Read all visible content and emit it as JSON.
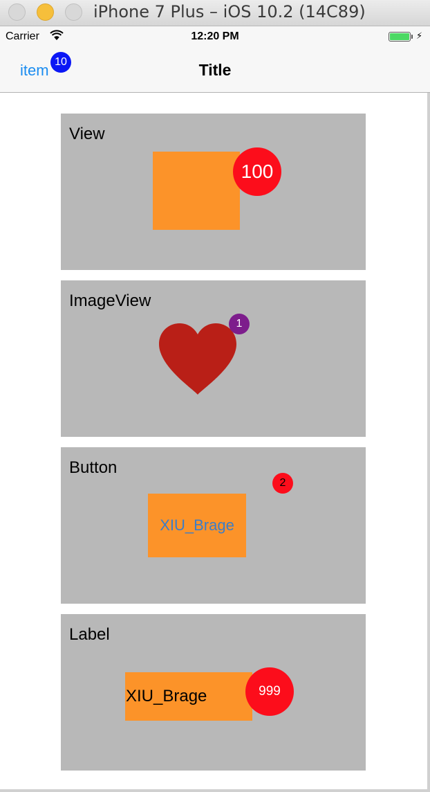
{
  "window": {
    "title": "iPhone 7 Plus – iOS 10.2 (14C89)"
  },
  "statusbar": {
    "carrier": "Carrier",
    "time": "12:20 PM",
    "battery_level": 1.0
  },
  "navbar": {
    "item_label": "item",
    "item_badge": "10",
    "title": "Title"
  },
  "panels": {
    "view": {
      "label": "View",
      "badge": "100"
    },
    "imageview": {
      "label": "ImageView",
      "badge": "1"
    },
    "button": {
      "label": "Button",
      "button_text": "XIU_Brage",
      "badge": "2"
    },
    "label": {
      "label": "Label",
      "label_text": "XIU_Brage",
      "badge": "999"
    }
  },
  "colors": {
    "orange": "#fc9329",
    "badge_red": "#fc0d1b",
    "badge_blue": "#0b17f5",
    "badge_purple": "#7d1d8c",
    "heart_red": "#b91f17",
    "panel_gray": "#b8b8b8",
    "tint_blue": "#1a8cf0"
  },
  "icons": [
    "wifi-icon",
    "battery-icon",
    "charging-bolt-icon",
    "heart-icon"
  ]
}
